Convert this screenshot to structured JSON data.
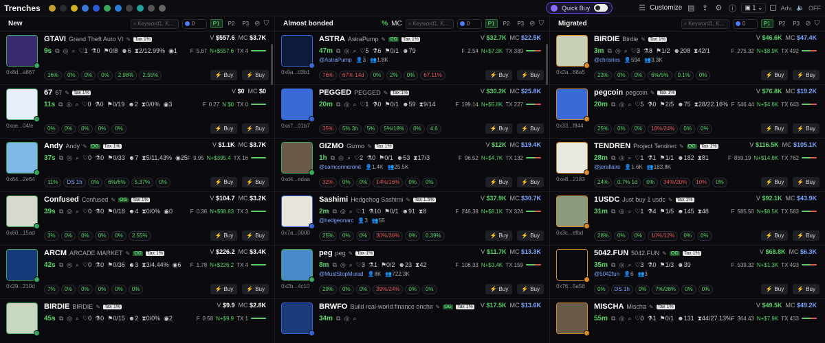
{
  "topbar": {
    "title": "Trenches",
    "quickbuy": "Quick Buy",
    "customize": "Customize",
    "page_sel": "1",
    "adv": "Adv.",
    "off": "OFF"
  },
  "columns": [
    {
      "title": "New",
      "pct": "",
      "mc_label": "",
      "search_placeholder": "Keyword1, K...",
      "amount": "0",
      "presets": [
        "P1",
        "P2",
        "P3"
      ],
      "cards": [
        {
          "ticker": "GTAVI",
          "name": "Grand Theft Auto VI",
          "og": false,
          "tax": "Tax 1%",
          "vol": "$557.6",
          "mc": "$3.7K",
          "age": "9s",
          "addr": "0x8d...a867",
          "s1": "1",
          "s2": "0",
          "s3": "0/8",
          "s4": "6",
          "s5": "2/12.99%",
          "s6": "1",
          "f": "5.67",
          "n": "N+$557.6",
          "tx": "TX 4",
          "handle": "",
          "h2": "",
          "h3": "",
          "stats": [
            "16%",
            "0%",
            "0%",
            "0%",
            "2.98%",
            "2.55%"
          ],
          "thumb": "#3a2a6b",
          "tcolor": "green"
        },
        {
          "ticker": "67",
          "name": "67",
          "og": false,
          "tax": "Tax 1%",
          "vol": "$0",
          "mc": "$0",
          "age": "11s",
          "addr": "0xae...04fe",
          "s1": "0",
          "s2": "0",
          "s3": "0/19",
          "s4": "2",
          "s5": "0/0%",
          "s6": "3",
          "f": "0.27",
          "n": "N $0",
          "tx": "TX 0",
          "handle": "",
          "h2": "",
          "h3": "",
          "stats": [
            "0%",
            "0%",
            "0%",
            "0%",
            "0%"
          ],
          "thumb": "#e8eef8",
          "tcolor": "green"
        },
        {
          "ticker": "Andy",
          "name": "Andy",
          "og": true,
          "tax": "Tax 1%",
          "vol": "$1.1K",
          "mc": "$3.7K",
          "age": "37s",
          "addr": "0x64...2e64",
          "s1": "0",
          "s2": "0",
          "s3": "0/33",
          "s4": "7",
          "s5": "5/11.43%",
          "s6": "25",
          "f": "9.95",
          "n": "N+$395.4",
          "tx": "TX 16",
          "handle": "",
          "h2": "",
          "h3": "",
          "stats": [
            "11%",
            "DS 1h",
            "0%",
            "6%/6%",
            "5.37%",
            "0%"
          ],
          "thumb": "#7fb8e8",
          "tcolor": "green"
        },
        {
          "ticker": "Confused",
          "name": "Confused",
          "og": true,
          "tax": "Tax 1%",
          "vol": "$104.7",
          "mc": "$3.2K",
          "age": "39s",
          "addr": "0x60...15ad",
          "s1": "0",
          "s2": "0",
          "s3": "0/18",
          "s4": "4",
          "s5": "0/0%",
          "s6": "0",
          "f": "0.36",
          "n": "N+$98.83",
          "tx": "TX 3",
          "handle": "",
          "h2": "",
          "h3": "",
          "stats": [
            "3%",
            "0%",
            "0%",
            "0%",
            "0%",
            "2.55%"
          ],
          "thumb": "#d8d8d0",
          "tcolor": "green"
        },
        {
          "ticker": "ARCM",
          "name": "ARCADE MARKET",
          "og": true,
          "tax": "Tax 1%",
          "vol": "$226.2",
          "mc": "$3.4K",
          "age": "42s",
          "addr": "0x29...210d",
          "s1": "0",
          "s2": "0",
          "s3": "0/36",
          "s4": "3",
          "s5": "3/4.44%",
          "s6": "6",
          "f": "1.78",
          "n": "N+$226.2",
          "tx": "TX 4",
          "handle": "",
          "h2": "",
          "h3": "",
          "stats": [
            "7%",
            "0%",
            "0%",
            "0%",
            "0%",
            "0%"
          ],
          "thumb": "#173a7a",
          "tcolor": "green"
        },
        {
          "ticker": "BIRDIE",
          "name": "BIRDIE",
          "og": false,
          "tax": "Tax 1%",
          "vol": "$9.9",
          "mc": "$2.8K",
          "age": "45s",
          "addr": "",
          "s1": "0",
          "s2": "0",
          "s3": "0/15",
          "s4": "2",
          "s5": "0/0%",
          "s6": "2",
          "f": "0.58",
          "n": "N+$9.9",
          "tx": "TX 1",
          "handle": "",
          "h2": "",
          "h3": "",
          "stats": [],
          "thumb": "#c8d8c0",
          "tcolor": "green"
        }
      ]
    },
    {
      "title": "Almost bonded",
      "pct": "%",
      "mc_label": "MC",
      "search_placeholder": "Keyword1, K...",
      "amount": "0",
      "presets": [
        "P1",
        "P2",
        "P3"
      ],
      "cards": [
        {
          "ticker": "ASTRA",
          "name": "AstraPump",
          "og": true,
          "tax": "Tax 1%",
          "vol": "$32.7K",
          "mc": "$22.5K",
          "age": "47m",
          "addr": "0x9a...d3b1",
          "s1": "5",
          "s2": "6",
          "s3": "0/1",
          "s4": "79",
          "s5": "",
          "s6": "",
          "f": "2.54",
          "n": "N+$7.3K",
          "tx": "TX 339",
          "handle": "@AstraPump",
          "h2": "3",
          "h3": "1.8K",
          "stats": [
            "76%",
            "67% 14d",
            "0%",
            "2%",
            "0%",
            "67.11%"
          ],
          "thumb": "#0d1a3a",
          "tcolor": "blue"
        },
        {
          "ticker": "PEGGED",
          "name": "PEGGED",
          "og": false,
          "tax": "Tax 1%",
          "vol": "$30.2K",
          "mc": "$25.8K",
          "age": "20m",
          "addr": "0xa7...01b7",
          "s1": "1",
          "s2": "0",
          "s3": "0/1",
          "s4": "59",
          "s5": "9/14",
          "s6": "",
          "f": "199.14",
          "n": "N+$5.8K",
          "tx": "TX 227",
          "handle": "",
          "h2": "",
          "h3": "",
          "stats": [
            "35%",
            "5% 3h",
            "5%",
            "5%/18%",
            "0%",
            "4.6"
          ],
          "thumb": "#3a6ad6",
          "tcolor": "blue"
        },
        {
          "ticker": "GIZMO",
          "name": "Gizmo",
          "og": false,
          "tax": "Tax 1%",
          "vol": "$12K",
          "mc": "$19.4K",
          "age": "1h",
          "addr": "0xd4...edaa",
          "s1": "2",
          "s2": "0",
          "s3": "0/1",
          "s4": "53",
          "s5": "17/3",
          "s6": "",
          "f": "96.52",
          "n": "N+$4.7K",
          "tx": "TX 132",
          "handle": "@samconnerone",
          "h2": "1.4K",
          "h3": "25.5K",
          "stats": [
            "32%",
            "0%",
            "0%",
            "14%/16%",
            "0%",
            "0%"
          ],
          "thumb": "#6a5a4a",
          "tcolor": "green"
        },
        {
          "ticker": "Sashimi",
          "name": "Hedgehog Sashimi",
          "og": false,
          "tax": "Tax 1.5%",
          "vol": "$37.9K",
          "mc": "$30.7K",
          "age": "2m",
          "addr": "0x7a...0000",
          "s1": "1",
          "s2": "10",
          "s3": "0/1",
          "s4": "91",
          "s5": "8",
          "s6": "",
          "f": "246.38",
          "n": "N+$8.1K",
          "tx": "TX 324",
          "handle": "@hedgeonarc",
          "h2": "3",
          "h3": "55",
          "stats": [
            "25%",
            "0%",
            "0%",
            "30%/36%",
            "0%",
            "0.39%"
          ],
          "thumb": "#e8e4dc",
          "tcolor": "blue"
        },
        {
          "ticker": "peg",
          "name": "peg",
          "og": false,
          "tax": "Tax 1%",
          "vol": "$11.7K",
          "mc": "$13.3K",
          "age": "8m",
          "addr": "0x2b...4c10",
          "s1": "3",
          "s2": "1",
          "s3": "0/2",
          "s4": "23",
          "s5": "42",
          "s6": "",
          "f": "106.33",
          "n": "N+$3.4K",
          "tx": "TX 159",
          "handle": "@MustStopMurad",
          "h2": "8K",
          "h3": "722.3K",
          "stats": [
            "29%",
            "0%",
            "0%",
            "39%/24%",
            "0%",
            "0%"
          ],
          "thumb": "#4a8ac8",
          "tcolor": "green"
        },
        {
          "ticker": "BRWFO",
          "name": "Build real-world finance onchain",
          "og": true,
          "tax": "Tax 1%",
          "vol": "$17.5K",
          "mc": "$13.6K",
          "age": "34m",
          "addr": "",
          "s1": "",
          "s2": "",
          "s3": "",
          "s4": "",
          "s5": "",
          "s6": "",
          "f": "",
          "n": "",
          "tx": "",
          "handle": "",
          "h2": "",
          "h3": "",
          "stats": [],
          "thumb": "#1a3a7a",
          "tcolor": "blue"
        }
      ]
    },
    {
      "title": "Migrated",
      "pct": "",
      "mc_label": "",
      "search_placeholder": "Keyword1, K...",
      "amount": "0",
      "presets": [
        "P1",
        "P2",
        "P3"
      ],
      "cards": [
        {
          "ticker": "BIRDIE",
          "name": "Birdie",
          "og": false,
          "tax": "Tax 1%",
          "vol": "$46.6K",
          "mc": "$47.4K",
          "age": "3m",
          "addr": "0x2a...68a5",
          "s1": "3",
          "s2": "8",
          "s3": "1/2",
          "s4": "208",
          "s5": "42/1",
          "s6": "",
          "f": "275.32",
          "n": "N+$8.9K",
          "tx": "TX 492",
          "handle": "@chrisries",
          "h2": "594",
          "h3": "3.3K",
          "stats": [
            "23%",
            "0%",
            "0%",
            "6%/5%",
            "0.1%",
            "0%"
          ],
          "thumb": "#c8d0b8",
          "tcolor": "orange"
        },
        {
          "ticker": "pegcoin",
          "name": "pegcoin",
          "og": false,
          "tax": "Tax 1%",
          "vol": "$76.8K",
          "mc": "$19.2K",
          "age": "20m",
          "addr": "0x33...f844",
          "s1": "5",
          "s2": "0",
          "s3": "2/5",
          "s4": "75",
          "s5": "28/22.16%",
          "s6": "",
          "f": "546.44",
          "n": "N+$4.6K",
          "tx": "TX 643",
          "handle": "",
          "h2": "",
          "h3": "",
          "stats": [
            "25%",
            "0%",
            "0%",
            "18%/24%",
            "0%",
            "0%"
          ],
          "thumb": "#3a6ad6",
          "tcolor": "orange"
        },
        {
          "ticker": "TENDREN",
          "name": "Project Tendren",
          "og": true,
          "tax": "Tax 1%",
          "vol": "$116.5K",
          "mc": "$105.1K",
          "age": "28m",
          "addr": "0xe8...2183",
          "s1": "1",
          "s2": "1",
          "s3": "1/1",
          "s4": "182",
          "s5": "81",
          "s6": "",
          "f": "859.19",
          "n": "N+$14.8K",
          "tx": "TX 762",
          "handle": "@jerallaire",
          "h2": "1.6K",
          "h3": "183.8K",
          "stats": [
            "24%",
            "0.7% 1d",
            "0%",
            "34%/20%",
            "10%",
            "0%"
          ],
          "thumb": "#e8e8e0",
          "tcolor": "orange"
        },
        {
          "ticker": "1USDC",
          "name": "Just buy 1 usdc",
          "og": false,
          "tax": "Tax 1%",
          "vol": "$92.1K",
          "mc": "$43.9K",
          "age": "31m",
          "addr": "0x3c...efbd",
          "s1": "1",
          "s2": "4",
          "s3": "1/5",
          "s4": "145",
          "s5": "48",
          "s6": "",
          "f": "585.50",
          "n": "N+$8.5K",
          "tx": "TX 583",
          "handle": "",
          "h2": "",
          "h3": "",
          "stats": [
            "28%",
            "0%",
            "0%",
            "10%/12%",
            "0%",
            "0%"
          ],
          "thumb": "#8a9a7a",
          "tcolor": "orange"
        },
        {
          "ticker": "5042.FUN",
          "name": "5042.FUN",
          "og": true,
          "tax": "Tax 1%",
          "vol": "$68.8K",
          "mc": "$6.3K",
          "age": "35m",
          "addr": "0x76...5a58",
          "s1": "3",
          "s2": "0",
          "s3": "1/3",
          "s4": "39",
          "s5": "",
          "s6": "",
          "f": "539.32",
          "n": "N+$1.3K",
          "tx": "TX 493",
          "handle": "@5042fun",
          "h2": "6",
          "h3": "3",
          "stats": [
            "0%",
            "DS 1h",
            "0%",
            "7%/28%",
            "0%",
            "0%"
          ],
          "thumb": "#0a0a10",
          "tcolor": "orange"
        },
        {
          "ticker": "MISCHA",
          "name": "Mischa",
          "og": false,
          "tax": "Tax 1%",
          "vol": "$49.5K",
          "mc": "$49.2K",
          "age": "55m",
          "addr": "",
          "s1": "0",
          "s2": "1",
          "s3": "0/1",
          "s4": "131",
          "s5": "44/27.13%",
          "s6": "",
          "f": "364.43",
          "n": "N+$7.9K",
          "tx": "TX 433",
          "handle": "",
          "h2": "",
          "h3": "",
          "stats": [],
          "thumb": "#6a5a48",
          "tcolor": "orange"
        }
      ]
    }
  ]
}
